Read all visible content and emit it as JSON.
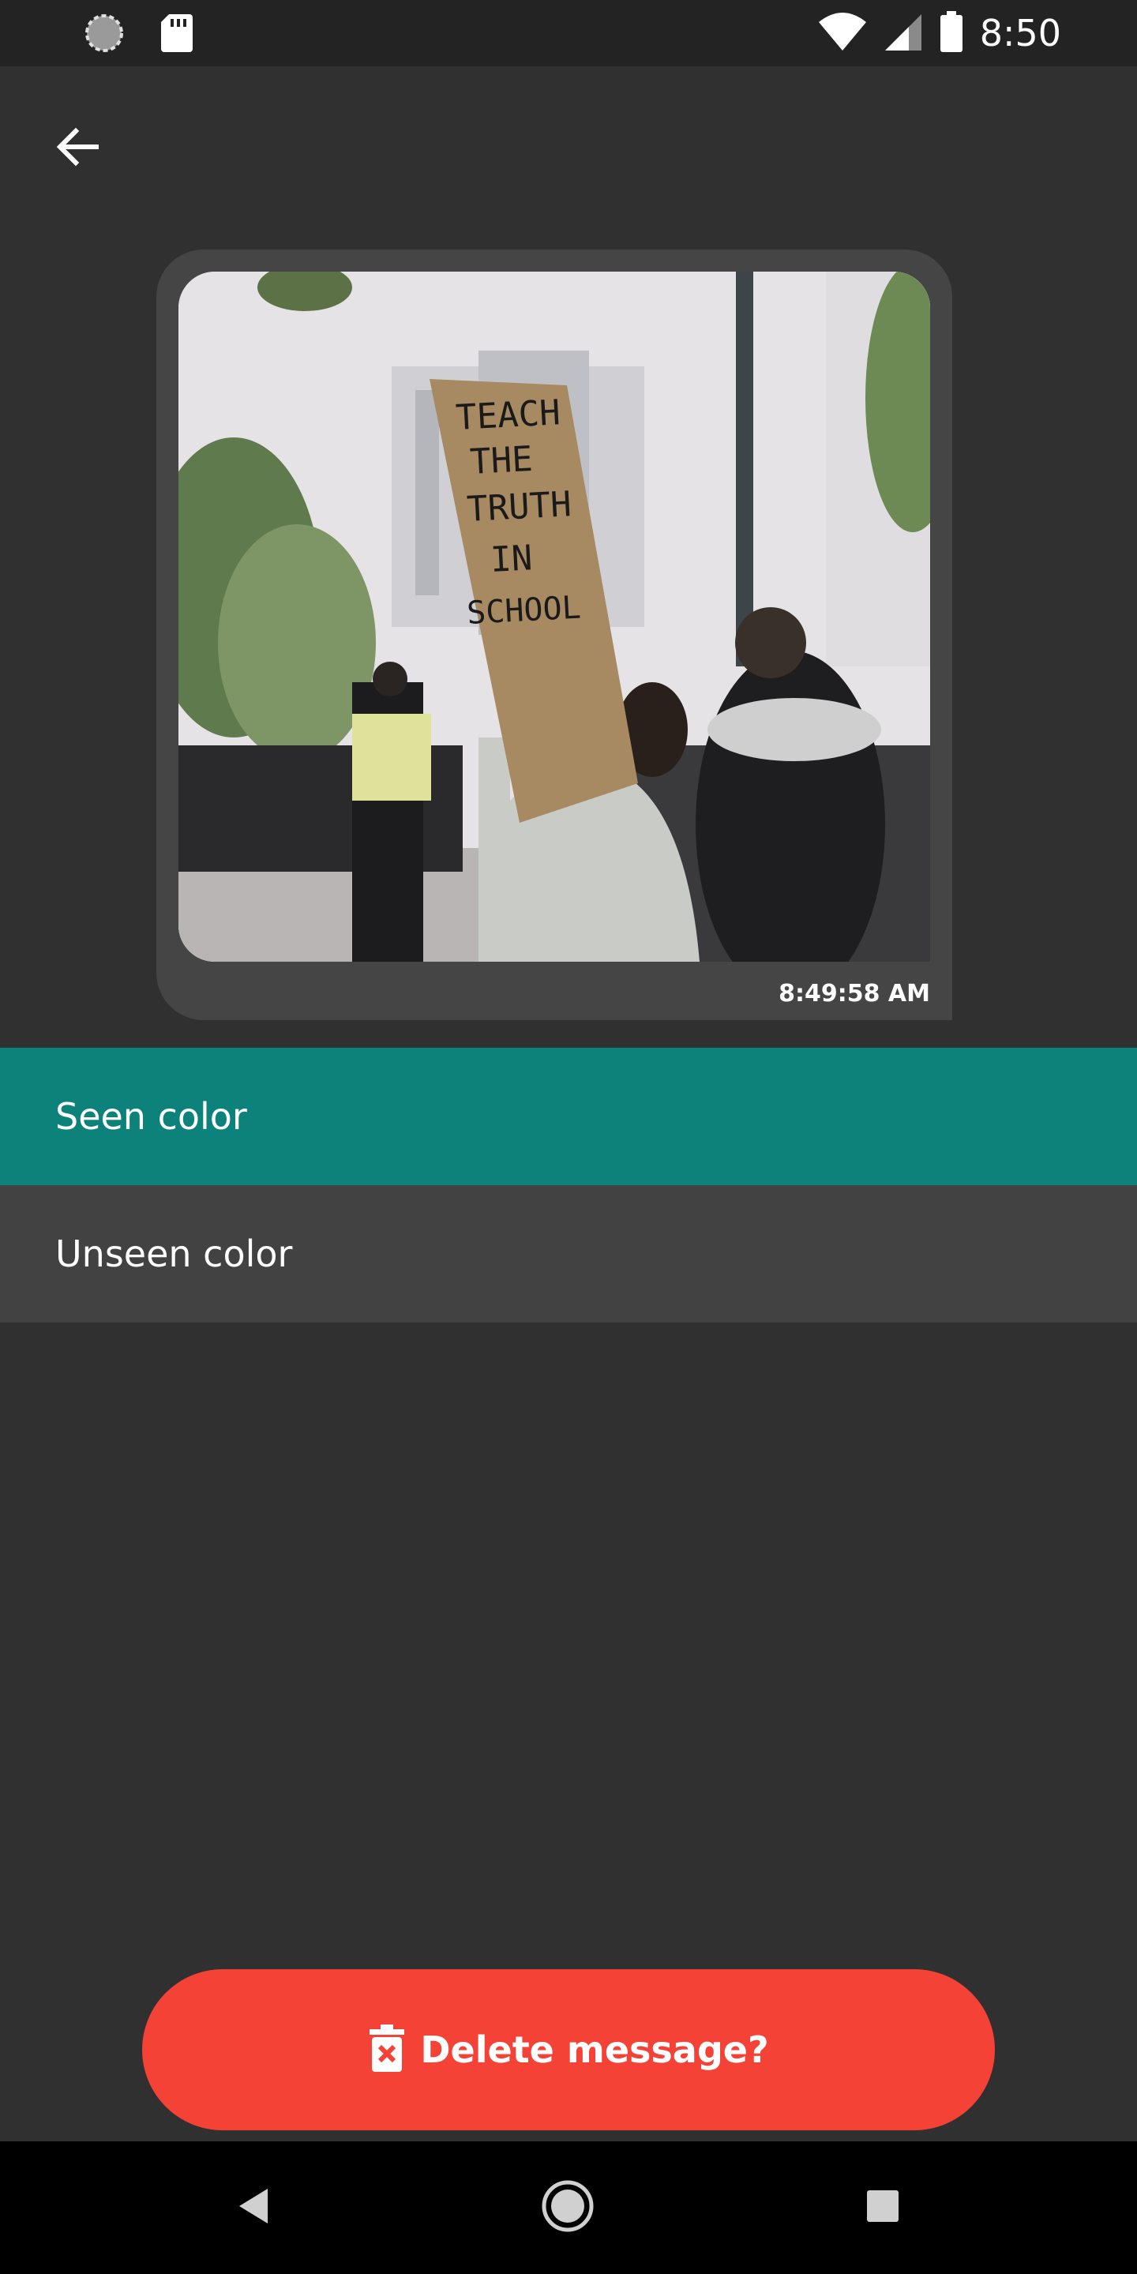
{
  "status_bar": {
    "time": "8:50",
    "icons": [
      "sync-icon",
      "sd-card-icon",
      "wifi-icon",
      "signal-icon",
      "battery-icon"
    ]
  },
  "app_bar": {
    "back_icon": "arrow-back-icon"
  },
  "message": {
    "image_sign_text": "TEACH THE TRUTH IN SCHOOL",
    "timestamp": "8:49:58 AM"
  },
  "options": {
    "seen_label": "Seen color",
    "unseen_label": "Unseen color"
  },
  "delete_button": {
    "label": "Delete message?",
    "icon": "trash-x-icon"
  },
  "nav_bar": {
    "icons": [
      "back-triangle-icon",
      "home-circle-icon",
      "recents-square-icon"
    ]
  },
  "colors": {
    "background": "#303030",
    "status_bar": "#232323",
    "bubble": "#454545",
    "seen": "#0d827a",
    "unseen": "#424242",
    "delete": "#f44236"
  }
}
